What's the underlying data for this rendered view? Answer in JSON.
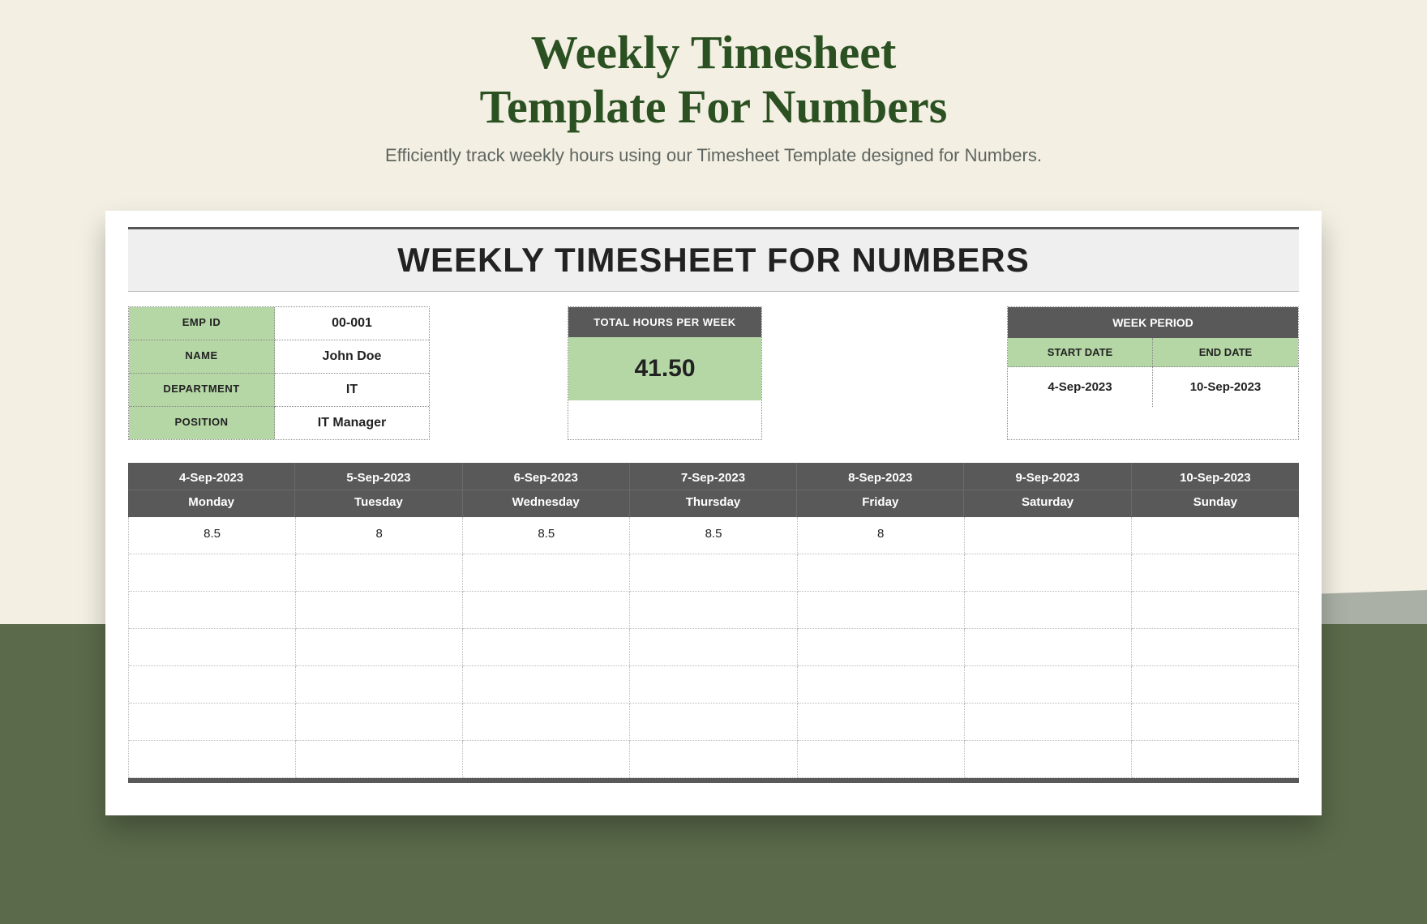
{
  "header": {
    "title_line1": "Weekly Timesheet",
    "title_line2": "Template For Numbers",
    "subtitle": "Efficiently track weekly hours using our Timesheet Template designed for Numbers."
  },
  "sheet": {
    "title": "WEEKLY TIMESHEET FOR NUMBERS",
    "employee": {
      "labels": {
        "emp_id": "EMP ID",
        "name": "NAME",
        "department": "DEPARTMENT",
        "position": "POSITION"
      },
      "values": {
        "emp_id": "00-001",
        "name": "John Doe",
        "department": "IT",
        "position": "IT Manager"
      }
    },
    "total": {
      "label": "TOTAL  HOURS PER WEEK",
      "value": "41.50"
    },
    "week_period": {
      "heading": "WEEK PERIOD",
      "start_label": "START DATE",
      "end_label": "END DATE",
      "start_date": "4-Sep-2023",
      "end_date": "10-Sep-2023"
    },
    "days": [
      {
        "date": "4-Sep-2023",
        "name": "Monday",
        "hours": "8.5"
      },
      {
        "date": "5-Sep-2023",
        "name": "Tuesday",
        "hours": "8"
      },
      {
        "date": "6-Sep-2023",
        "name": "Wednesday",
        "hours": "8.5"
      },
      {
        "date": "7-Sep-2023",
        "name": "Thursday",
        "hours": "8.5"
      },
      {
        "date": "8-Sep-2023",
        "name": "Friday",
        "hours": "8"
      },
      {
        "date": "9-Sep-2023",
        "name": "Saturday",
        "hours": ""
      },
      {
        "date": "10-Sep-2023",
        "name": "Sunday",
        "hours": ""
      }
    ],
    "blank_rows": 6
  }
}
